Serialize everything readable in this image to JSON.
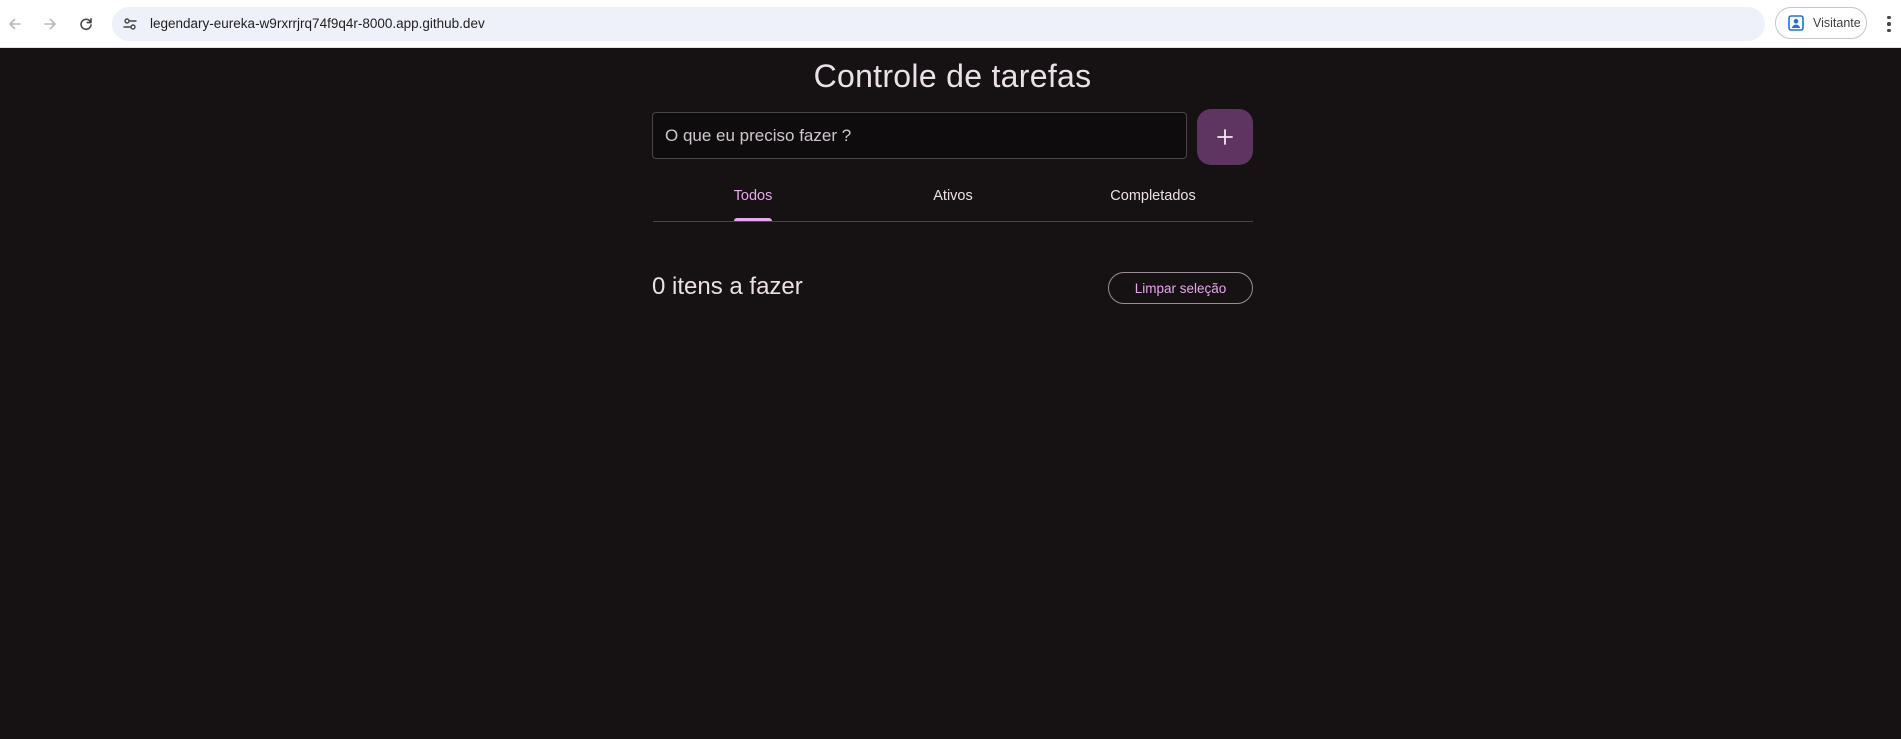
{
  "browser": {
    "url": "legendary-eureka-w9rxrrjrq74f9q4r-8000.app.github.dev",
    "profile_label": "Visitante",
    "icons": [
      "back-arrow-icon",
      "forward-arrow-icon",
      "reload-icon",
      "site-info-icon",
      "profile-icon",
      "more-vert-icon"
    ]
  },
  "app": {
    "title": "Controle de tarefas",
    "input": {
      "placeholder": "O que eu preciso fazer ?",
      "value": ""
    },
    "add_button": {
      "icon": "plus-icon"
    },
    "tabs": [
      {
        "label": "Todos",
        "active": true
      },
      {
        "label": "Ativos",
        "active": false
      },
      {
        "label": "Completados",
        "active": false
      }
    ],
    "items_count_text": "0 itens a fazer",
    "clear_button_label": "Limpar seleção",
    "colors": {
      "background": "#161214",
      "accent": "#e8a6ee",
      "add_button": "#5e3561",
      "text": "#ece0e8"
    }
  }
}
